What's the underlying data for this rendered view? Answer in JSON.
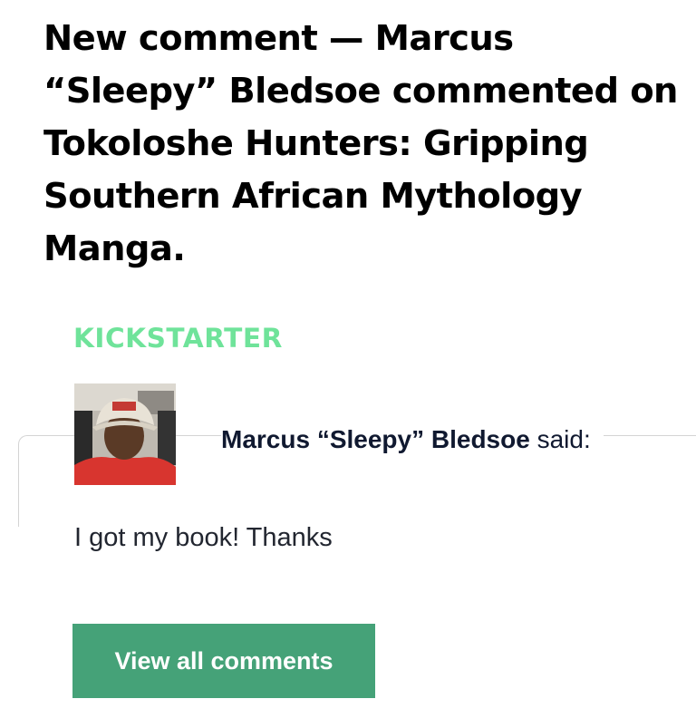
{
  "email": {
    "subject": "New comment — Marcus “Sleepy” Bledsoe commented on Tokoloshe Hunters: Gripping Southern African Mythology Manga."
  },
  "brand": {
    "logo_text": "KICKSTARTER",
    "color": "#6fe39a"
  },
  "comment": {
    "author": "Marcus “Sleepy” Bledsoe",
    "said_suffix": " said:",
    "body": "I got my book! Thanks",
    "avatar_icon": "user-avatar-photo"
  },
  "actions": {
    "view_all_label": "View all comments",
    "button_color": "#45a278"
  }
}
